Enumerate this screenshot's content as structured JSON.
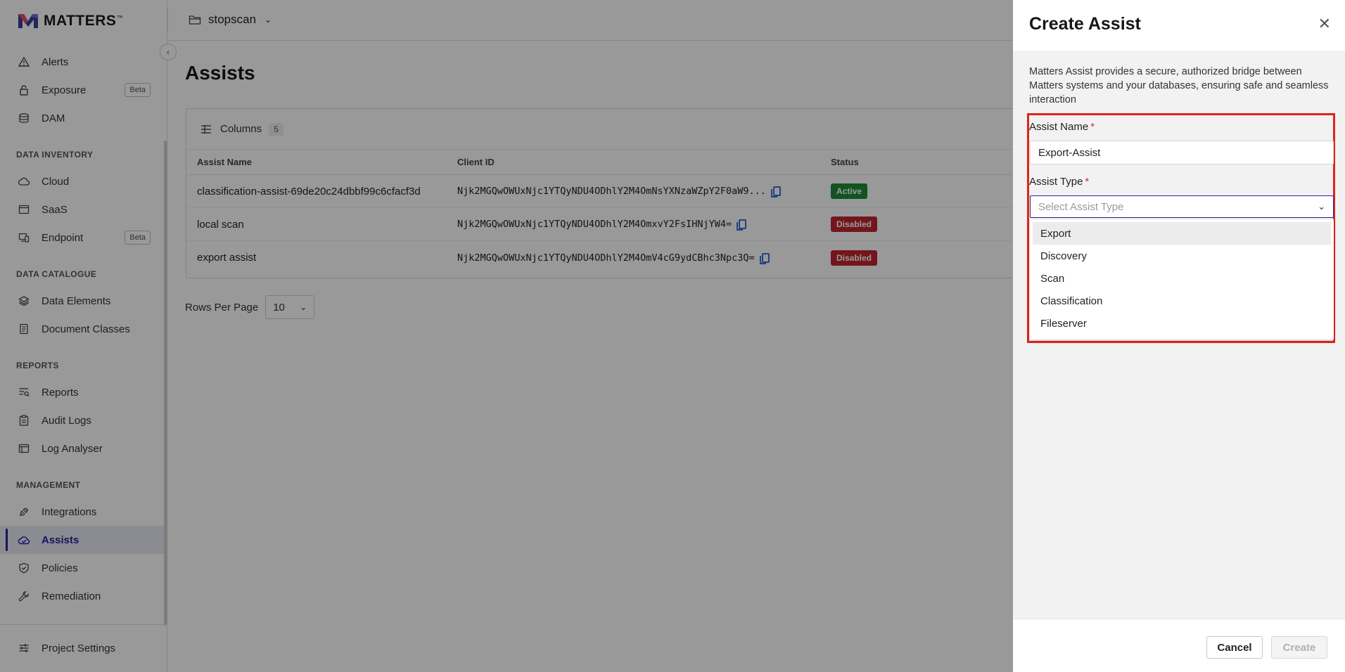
{
  "app": {
    "name": "MATTERS",
    "trademark": "™"
  },
  "topbar": {
    "project": "stopscan"
  },
  "sidebar": {
    "top_items": [
      {
        "label": "Alerts",
        "icon": "alert-triangle-icon"
      },
      {
        "label": "Exposure",
        "icon": "lock-icon",
        "badge": "Beta"
      },
      {
        "label": "DAM",
        "icon": "database-icon"
      }
    ],
    "sections": [
      {
        "title": "DATA INVENTORY",
        "items": [
          {
            "label": "Cloud",
            "icon": "cloud-icon"
          },
          {
            "label": "SaaS",
            "icon": "saas-icon"
          },
          {
            "label": "Endpoint",
            "icon": "endpoint-icon",
            "badge": "Beta"
          }
        ]
      },
      {
        "title": "DATA CATALOGUE",
        "items": [
          {
            "label": "Data Elements",
            "icon": "layers-icon"
          },
          {
            "label": "Document Classes",
            "icon": "document-icon"
          }
        ]
      },
      {
        "title": "REPORTS",
        "items": [
          {
            "label": "Reports",
            "icon": "report-icon"
          },
          {
            "label": "Audit Logs",
            "icon": "clipboard-icon"
          },
          {
            "label": "Log Analyser",
            "icon": "window-icon"
          }
        ]
      },
      {
        "title": "MANAGEMENT",
        "items": [
          {
            "label": "Integrations",
            "icon": "plug-icon"
          },
          {
            "label": "Assists",
            "icon": "assist-icon",
            "active": true
          },
          {
            "label": "Policies",
            "icon": "shield-check-icon"
          },
          {
            "label": "Remediation",
            "icon": "wrench-icon"
          }
        ]
      }
    ],
    "footer": {
      "label": "Project Settings",
      "icon": "sliders-icon"
    }
  },
  "main": {
    "title": "Assists",
    "columns_label": "Columns",
    "columns_count": "5",
    "headers": [
      "Assist Name",
      "Client ID",
      "Status"
    ],
    "rows": [
      {
        "name": "classification-assist-69de20c24dbbf99c6cfacf3d",
        "client_id": "Njk2MGQwOWUxNjc1YTQyNDU4ODhlY2M4OmNsYXNzaWZpY2F0aW9...",
        "status": "Active"
      },
      {
        "name": "local scan",
        "client_id": "Njk2MGQwOWUxNjc1YTQyNDU4ODhlY2M4OmxvY2FsIHNjYW4=",
        "status": "Disabled"
      },
      {
        "name": "export assist",
        "client_id": "Njk2MGQwOWUxNjc1YTQyNDU4ODhlY2M4OmV4cG9ydCBhc3Npc3Q=",
        "status": "Disabled"
      }
    ],
    "rows_per_page_label": "Rows Per Page",
    "rows_per_page_value": "10"
  },
  "drawer": {
    "title": "Create Assist",
    "description": "Matters Assist provides a secure, authorized bridge between Matters systems and your databases, ensuring safe and seamless interaction",
    "name_label": "Assist Name",
    "name_value": "Export-Assist",
    "type_label": "Assist Type",
    "required_mark": "*",
    "type_placeholder": "Select Assist Type",
    "type_options": [
      "Export",
      "Discovery",
      "Scan",
      "Classification",
      "Fileserver"
    ],
    "cancel_label": "Cancel",
    "create_label": "Create"
  },
  "colors": {
    "brand": "#2c1f9f",
    "active_badge": "#1f8a3a",
    "disabled_badge": "#c0262d",
    "highlight": "#e0241b"
  }
}
